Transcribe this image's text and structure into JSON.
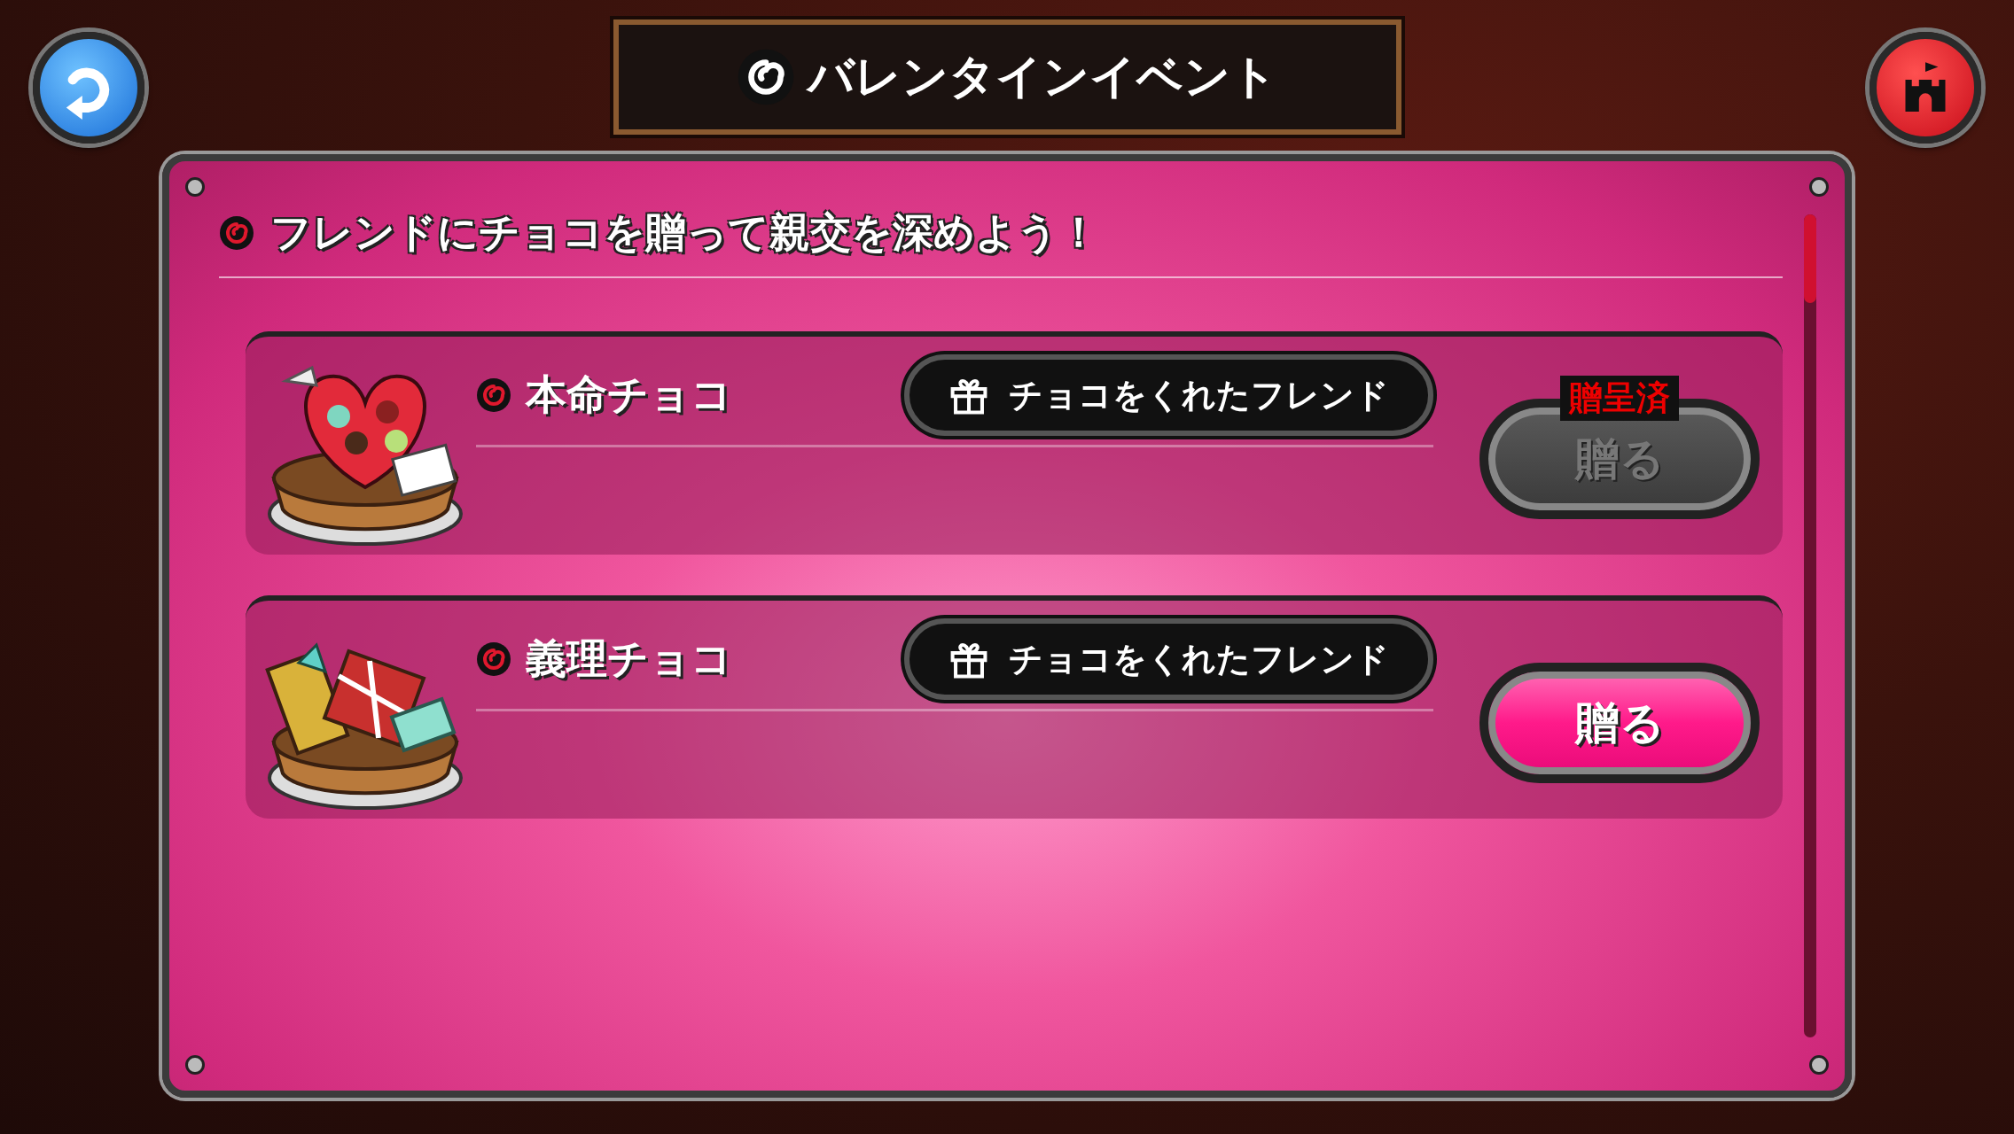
{
  "header": {
    "title": "バレンタインイベント"
  },
  "panel": {
    "subtitle": "フレンドにチョコを贈って親交を深めよう！",
    "items": [
      {
        "kind": "heart",
        "name": "本命チョコ",
        "friends_button": "チョコをくれたフレンド",
        "send_button": "贈る",
        "sent": true,
        "sent_label": "贈呈済"
      },
      {
        "kind": "box",
        "name": "義理チョコ",
        "friends_button": "チョコをくれたフレンド",
        "send_button": "贈る",
        "sent": false
      }
    ]
  }
}
